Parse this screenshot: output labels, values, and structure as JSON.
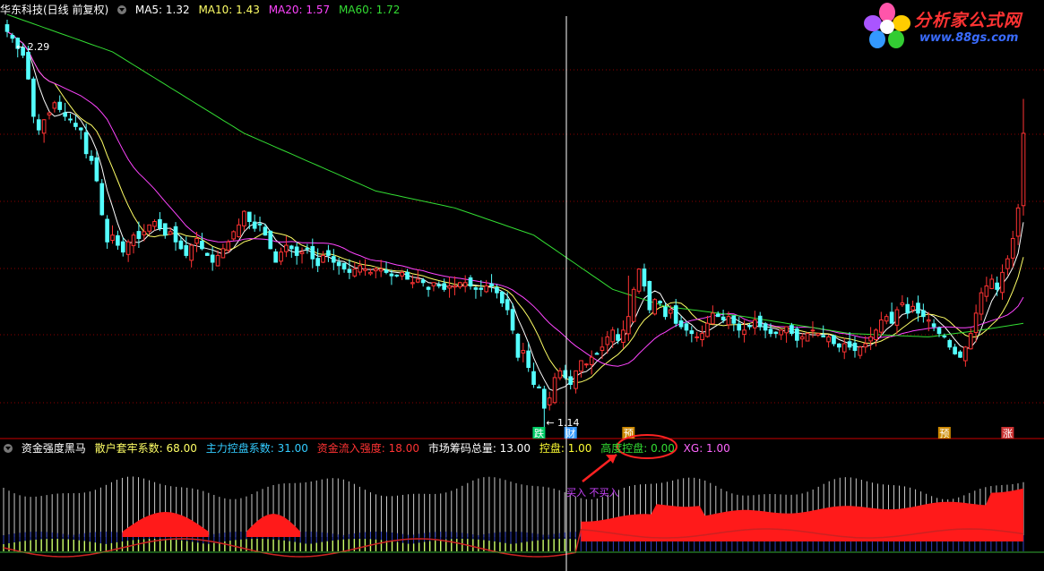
{
  "header": {
    "title": "华东科技(日线 前复权)",
    "ma": [
      {
        "label": "MA5: 1.32",
        "color": "#ffffff"
      },
      {
        "label": "MA10: 1.43",
        "color": "#ffff66"
      },
      {
        "label": "MA20: 1.57",
        "color": "#ff44ff"
      },
      {
        "label": "MA60: 1.72",
        "color": "#33dd33"
      }
    ]
  },
  "logo": {
    "brand": "分析家公式网",
    "url": "www.88gs.com"
  },
  "indicator": {
    "name": "资金强度黑马",
    "params": [
      {
        "label": "散户套牢系数: 68.00",
        "color": "#ffff66"
      },
      {
        "label": "主力控盘系数: 31.00",
        "color": "#33ccff"
      },
      {
        "label": "资金流入强度: 18.00",
        "color": "#ff3333"
      },
      {
        "label": "市场筹码总量: 13.00",
        "color": "#ffffff"
      },
      {
        "label": "控盘: 1.00",
        "color": "#ffff33"
      },
      {
        "label": "高度控盘: 0.00",
        "color": "#33dd33"
      },
      {
        "label": "XG: 1.00",
        "color": "#ff66ff"
      }
    ],
    "annotation": "买入 不买入"
  },
  "chart_data": {
    "type": "candlestick",
    "high_label": "2.29",
    "low_label": "1.14",
    "ylim": [
      1.1,
      2.3
    ],
    "markers": [
      {
        "label": "跌",
        "bar": 101,
        "color": "#00cc66"
      },
      {
        "label": "财",
        "bar": 107,
        "color": "#3399ff"
      },
      {
        "label": "预",
        "bar": 118,
        "color": "#cc8800"
      },
      {
        "label": "预",
        "bar": 178,
        "color": "#cc8800"
      },
      {
        "label": "涨",
        "bar": 190,
        "color": "#cc3333"
      }
    ],
    "cursor_bar": 105,
    "close": [
      2.26,
      2.24,
      2.21,
      2.19,
      2.12,
      2.01,
      1.97,
      2.0,
      2.02,
      2.05,
      2.03,
      2.01,
      2.0,
      1.98,
      1.97,
      1.9,
      1.88,
      1.82,
      1.72,
      1.64,
      1.66,
      1.63,
      1.61,
      1.64,
      1.66,
      1.65,
      1.67,
      1.69,
      1.7,
      1.68,
      1.66,
      1.67,
      1.64,
      1.62,
      1.6,
      1.63,
      1.65,
      1.62,
      1.6,
      1.58,
      1.6,
      1.62,
      1.64,
      1.67,
      1.69,
      1.73,
      1.7,
      1.68,
      1.69,
      1.66,
      1.62,
      1.58,
      1.61,
      1.63,
      1.62,
      1.6,
      1.61,
      1.62,
      1.59,
      1.57,
      1.6,
      1.6,
      1.58,
      1.57,
      1.56,
      1.55,
      1.56,
      1.57,
      1.56,
      1.55,
      1.56,
      1.56,
      1.55,
      1.54,
      1.54,
      1.55,
      1.53,
      1.52,
      1.53,
      1.52,
      1.5,
      1.52,
      1.51,
      1.5,
      1.51,
      1.51,
      1.52,
      1.52,
      1.51,
      1.5,
      1.5,
      1.51,
      1.51,
      1.49,
      1.46,
      1.44,
      1.38,
      1.3,
      1.32,
      1.27,
      1.22,
      1.21,
      1.15,
      1.18,
      1.24,
      1.26,
      1.24,
      1.22,
      1.26,
      1.29,
      1.28,
      1.3,
      1.31,
      1.33,
      1.36,
      1.38,
      1.35,
      1.38,
      1.42,
      1.5,
      1.56,
      1.51,
      1.44,
      1.47,
      1.46,
      1.42,
      1.44,
      1.4,
      1.39,
      1.38,
      1.37,
      1.36,
      1.37,
      1.4,
      1.43,
      1.42,
      1.41,
      1.42,
      1.4,
      1.38,
      1.38,
      1.39,
      1.41,
      1.39,
      1.38,
      1.37,
      1.37,
      1.38,
      1.39,
      1.37,
      1.35,
      1.36,
      1.37,
      1.38,
      1.37,
      1.36,
      1.36,
      1.34,
      1.33,
      1.34,
      1.33,
      1.32,
      1.33,
      1.34,
      1.36,
      1.38,
      1.41,
      1.42,
      1.4,
      1.44,
      1.46,
      1.43,
      1.45,
      1.43,
      1.42,
      1.41,
      1.39,
      1.37,
      1.36,
      1.33,
      1.31,
      1.3,
      1.33,
      1.37,
      1.43,
      1.49,
      1.51,
      1.53,
      1.5,
      1.55,
      1.59,
      1.65,
      1.74,
      1.96
    ],
    "ma60_anchor": [
      [
        0,
        2.31
      ],
      [
        20,
        2.2
      ],
      [
        45,
        1.96
      ],
      [
        70,
        1.79
      ],
      [
        85,
        1.74
      ],
      [
        100,
        1.66
      ],
      [
        115,
        1.5
      ],
      [
        125,
        1.45
      ],
      [
        140,
        1.42
      ],
      [
        160,
        1.37
      ],
      [
        175,
        1.36
      ],
      [
        185,
        1.38
      ],
      [
        193,
        1.4
      ]
    ]
  }
}
